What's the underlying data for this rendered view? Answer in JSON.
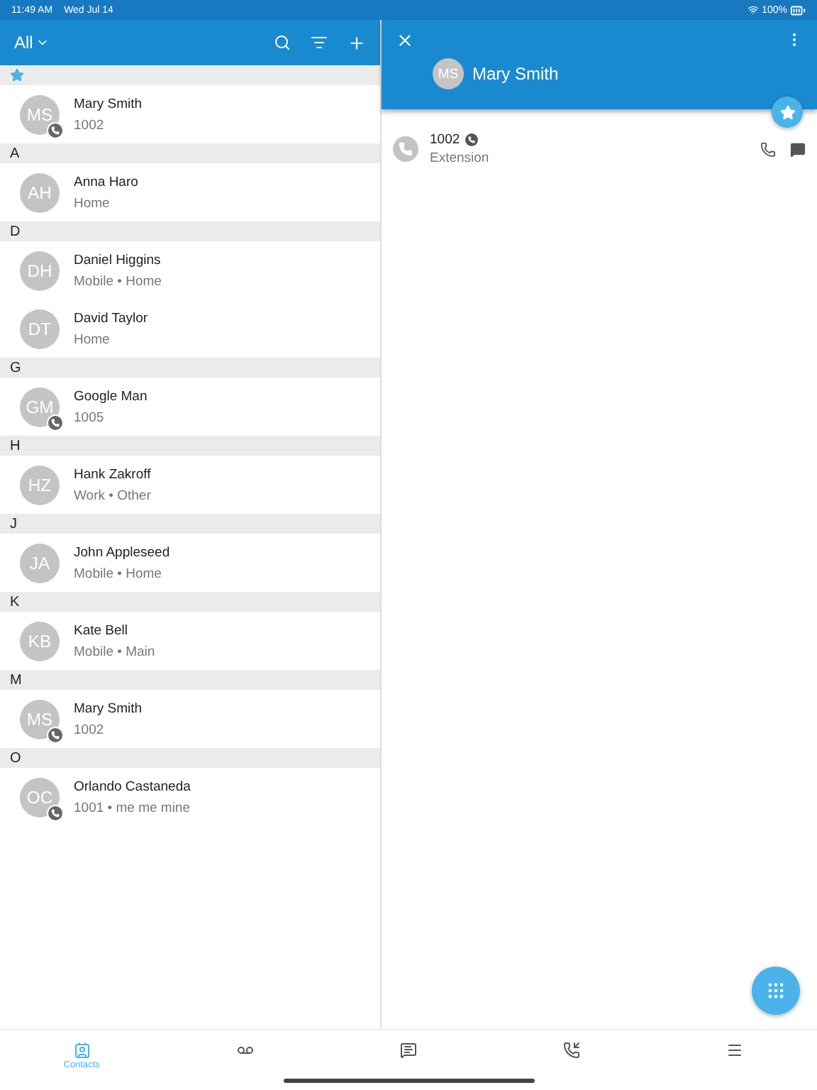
{
  "status_bar": {
    "time": "11:49 AM",
    "date": "Wed Jul 14",
    "battery": "100%"
  },
  "list_header": {
    "filter": "All"
  },
  "sections": [
    {
      "kind": "star",
      "contacts": [
        {
          "initials": "MS",
          "name": "Mary Smith",
          "detail": "1002",
          "phone_badge": true
        }
      ]
    },
    {
      "kind": "letter",
      "letter": "A",
      "contacts": [
        {
          "initials": "AH",
          "name": "Anna Haro",
          "detail": "Home",
          "phone_badge": false
        }
      ]
    },
    {
      "kind": "letter",
      "letter": "D",
      "contacts": [
        {
          "initials": "DH",
          "name": "Daniel Higgins",
          "detail": "Mobile • Home",
          "phone_badge": false
        },
        {
          "initials": "DT",
          "name": "David Taylor",
          "detail": "Home",
          "phone_badge": false
        }
      ]
    },
    {
      "kind": "letter",
      "letter": "G",
      "contacts": [
        {
          "initials": "GM",
          "name": "Google Man",
          "detail": "1005",
          "phone_badge": true
        }
      ]
    },
    {
      "kind": "letter",
      "letter": "H",
      "contacts": [
        {
          "initials": "HZ",
          "name": "Hank Zakroff",
          "detail": "Work • Other",
          "phone_badge": false
        }
      ]
    },
    {
      "kind": "letter",
      "letter": "J",
      "contacts": [
        {
          "initials": "JA",
          "name": "John Appleseed",
          "detail": "Mobile • Home",
          "phone_badge": false
        }
      ]
    },
    {
      "kind": "letter",
      "letter": "K",
      "contacts": [
        {
          "initials": "KB",
          "name": "Kate Bell",
          "detail": "Mobile • Main",
          "phone_badge": false
        }
      ]
    },
    {
      "kind": "letter",
      "letter": "M",
      "contacts": [
        {
          "initials": "MS",
          "name": "Mary Smith",
          "detail": "1002",
          "phone_badge": true
        }
      ]
    },
    {
      "kind": "letter",
      "letter": "O",
      "contacts": [
        {
          "initials": "OC",
          "name": "Orlando Castaneda",
          "detail": "1001 • me me mine",
          "phone_badge": true
        }
      ]
    }
  ],
  "detail": {
    "initials": "MS",
    "name": "Mary Smith",
    "favorite": true,
    "numbers": [
      {
        "number": "1002",
        "type": "Extension"
      }
    ]
  },
  "tabs": [
    {
      "kind": "contacts",
      "label": "Contacts",
      "selected": true
    },
    {
      "kind": "voicemail",
      "selected": false
    },
    {
      "kind": "messages",
      "selected": false
    },
    {
      "kind": "calls",
      "selected": false
    },
    {
      "kind": "menu",
      "selected": false
    }
  ]
}
